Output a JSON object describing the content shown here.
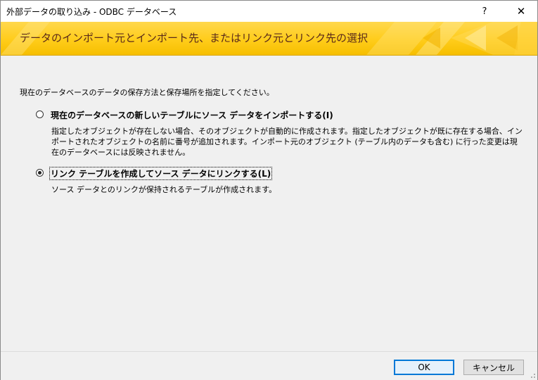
{
  "window": {
    "title": "外部データの取り込み - ODBC データベース",
    "help_label": "?",
    "close_label": "✕"
  },
  "banner": {
    "title": "データのインポート元とインポート先、またはリンク元とリンク先の選択"
  },
  "content": {
    "intro": "現在のデータベースのデータの保存方法と保存場所を指定してください。",
    "options": [
      {
        "label": "現在のデータベースの新しいテーブルにソース データをインポートする(I)",
        "description": "指定したオブジェクトが存在しない場合、そのオブジェクトが自動的に作成されます。指定したオブジェクトが既に存在する場合、インポートされたオブジェクトの名前に番号が追加されます。インポート元のオブジェクト (テーブル内のデータも含む) に行った変更は現在のデータベースには反映されません。",
        "selected": false
      },
      {
        "label": "リンク テーブルを作成してソース データにリンクする(L)",
        "description": "ソース データとのリンクが保持されるテーブルが作成されます。",
        "selected": true
      }
    ]
  },
  "footer": {
    "ok_label": "OK",
    "cancel_label": "キャンセル"
  },
  "colors": {
    "banner": "#ffcc1a",
    "banner_text": "#5a2a1a",
    "ok_border": "#0078d7"
  }
}
